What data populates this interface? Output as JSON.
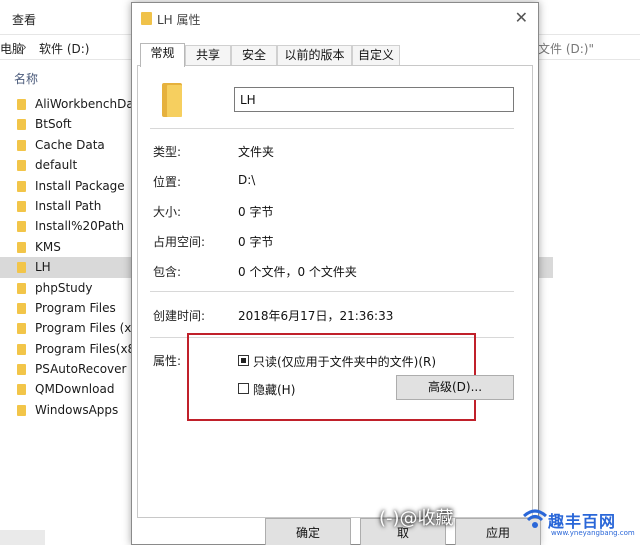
{
  "explorer": {
    "view_tab": "查看",
    "breadcrumb": [
      "电脑",
      "软件 (D:)"
    ],
    "breadcrumb_sep": "›",
    "search_hint": "文件 (D:)\"",
    "column_header": "名称",
    "folders": [
      {
        "name": "AliWorkbenchDat",
        "selected": false
      },
      {
        "name": "BtSoft",
        "selected": false
      },
      {
        "name": "Cache Data",
        "selected": false
      },
      {
        "name": "default",
        "selected": false
      },
      {
        "name": "Install Package",
        "selected": false
      },
      {
        "name": "Install Path",
        "selected": false
      },
      {
        "name": "Install%20Path",
        "selected": false
      },
      {
        "name": "KMS",
        "selected": false
      },
      {
        "name": "LH",
        "selected": true
      },
      {
        "name": "phpStudy",
        "selected": false
      },
      {
        "name": "Program Files",
        "selected": false
      },
      {
        "name": "Program Files (x8",
        "selected": false
      },
      {
        "name": "Program Files(x86",
        "selected": false
      },
      {
        "name": "PSAutoRecover",
        "selected": false
      },
      {
        "name": "QMDownload",
        "selected": false
      },
      {
        "name": "WindowsApps",
        "selected": false
      }
    ]
  },
  "dialog": {
    "title": "LH 属性",
    "close_glyph": "✕",
    "tabs": [
      "常规",
      "共享",
      "安全",
      "以前的版本",
      "自定义"
    ],
    "name_value": "LH",
    "fields": {
      "type_label": "类型:",
      "type_value": "文件夹",
      "location_label": "位置:",
      "location_value": "D:\\",
      "size_label": "大小:",
      "size_value": "0 字节",
      "size_on_disk_label": "占用空间:",
      "size_on_disk_value": "0 字节",
      "contains_label": "包含:",
      "contains_value": "0 个文件，0 个文件夹",
      "created_label": "创建时间:",
      "created_value": "2018年6月17日，21:36:33"
    },
    "attributes_label": "属性:",
    "readonly_label": "只读(仅应用于文件夹中的文件)(R)",
    "readonly_checked": true,
    "hidden_label": "隐藏(H)",
    "hidden_checked": false,
    "advanced_label": "高级(D)...",
    "ok_label": "确定",
    "cancel_label": "取",
    "apply_label": "应用"
  },
  "watermark": {
    "overlay_text": "(-)@收藏",
    "brand": "趣丰百网",
    "url": "www.yneyangbang.com"
  },
  "colors": {
    "highlight_border": "#c0202a",
    "folder_yellow": "#f2c549",
    "selection_bg": "#d9d9d9",
    "brand_blue": "#2a67d8"
  }
}
